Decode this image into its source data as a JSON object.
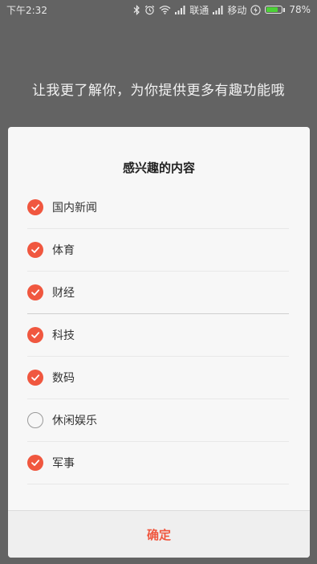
{
  "status_bar": {
    "time": "下午2:32",
    "carrier1": "联通",
    "carrier2": "移动",
    "battery": "78%",
    "battery_level": 0.78,
    "icons": [
      "bluetooth-icon",
      "alarm-icon",
      "wifi-icon",
      "signal-icon",
      "signal-icon",
      "charging-icon",
      "battery-icon"
    ]
  },
  "intro": "让我更了解你，为你提供更多有趣功能哦",
  "dialog": {
    "title": "感兴趣的内容",
    "options": [
      {
        "label": "国内新闻",
        "checked": true
      },
      {
        "label": "体育",
        "checked": true
      },
      {
        "label": "财经",
        "checked": true
      },
      {
        "label": "科技",
        "checked": true
      },
      {
        "label": "数码",
        "checked": true
      },
      {
        "label": "休闲娱乐",
        "checked": false
      },
      {
        "label": "军事",
        "checked": true
      }
    ],
    "confirm_label": "确定"
  },
  "colors": {
    "accent": "#f0573f",
    "overlay": "#636363",
    "dialog_bg": "#f7f7f7"
  }
}
